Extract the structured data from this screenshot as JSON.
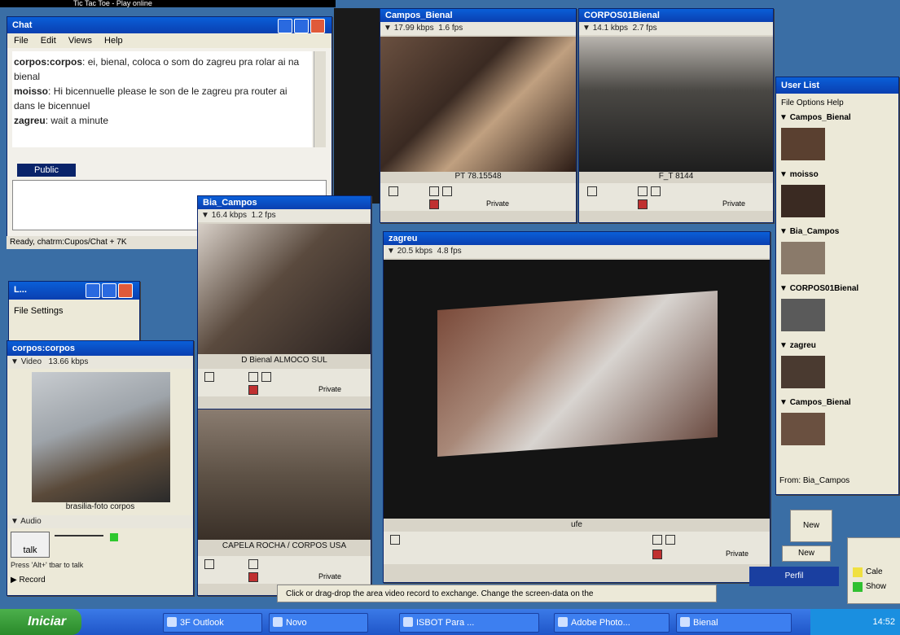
{
  "top_title": "Tic Tac Toe - Play online",
  "chat": {
    "title": "Chat",
    "menu": [
      "File",
      "Edit",
      "Views",
      "Help"
    ],
    "messages": [
      {
        "user": "corpos:corpos",
        "text": "ei, bienal, coloca o som do zagreu pra rolar ai na bienal"
      },
      {
        "user": "moisso",
        "text": "Hi bicennuelle please le son de le zagreu pra router ai dans le bicennuel"
      },
      {
        "user": "zagreu",
        "text": "wait a minute"
      }
    ],
    "public_button": "Public",
    "status": "Ready, chatrm:Cupos/Chat + 7K"
  },
  "settings_win": {
    "title": "L...",
    "menu": "File Settings"
  },
  "corpos_win": {
    "title": "corpos:corpos",
    "strip_label": "Video",
    "strip_rate": "13.66 kbps",
    "caption": "brasilia-foto corpos",
    "audio_label": "Audio",
    "talk_label": "talk",
    "hint": "Press 'Alt+' tbar to talk",
    "record_label": "Record"
  },
  "video_windows": [
    {
      "id": "campos-bienal",
      "title": "Campos_Bienal",
      "rate": "17.99 kbps",
      "fps": "1.6 fps",
      "caption": "PT 78.15548",
      "private": "Private"
    },
    {
      "id": "corpos01-bienal",
      "title": "CORPOS01Bienal",
      "rate": "14.1 kbps",
      "fps": "2.7 fps",
      "caption": "F_T 8144",
      "private": "Private"
    },
    {
      "id": "bia-campos",
      "title": "Bia_Campos",
      "rate": "16.4 kbps",
      "fps": "1.2 fps",
      "caption": "D Bienal ALMOCO SUL",
      "private": "Private"
    },
    {
      "id": "zagreu",
      "title": "zagreu",
      "rate": "20.5 kbps",
      "fps": "4.8 fps",
      "caption": "ufe",
      "private": "Private"
    }
  ],
  "capela_caption": "CAPELA ROCHA / CORPOS USA",
  "capela_private": "Private",
  "user_list": {
    "title": "User List",
    "menu": "File Options Help",
    "users": [
      "Campos_Bienal",
      "moisso",
      "Bia_Campos",
      "CORPOS01Bienal",
      "zagreu",
      "Campos_Bienal"
    ],
    "status": "From: Bia_Campos"
  },
  "drag_hint": "Click or drag-drop the area video record to exchange. Change the screen-data on the",
  "buttons": {
    "new": "New",
    "new2": "New",
    "profile": "Perfil"
  },
  "right_labels": [
    "Cale",
    "Show"
  ],
  "taskbar": {
    "start_label": "Iniciar",
    "tasks": [
      "3F Outlook",
      "Novo",
      "ISBOT Para ...",
      "Adobe Photo...",
      "Bienal"
    ],
    "clock": "14:52"
  }
}
